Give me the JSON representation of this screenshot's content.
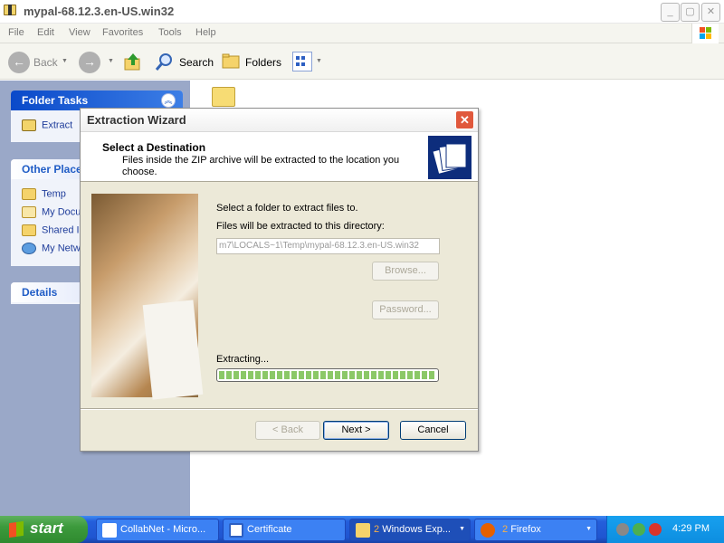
{
  "window": {
    "title": "mypal-68.12.3.en-US.win32"
  },
  "menu": [
    "File",
    "Edit",
    "View",
    "Favorites",
    "Tools",
    "Help"
  ],
  "toolbar": {
    "back_label": "Back",
    "search_label": "Search",
    "folders_label": "Folders"
  },
  "leftpane": {
    "folder_tasks": {
      "title": "Folder Tasks",
      "items": [
        "Extract"
      ]
    },
    "other_places": {
      "title": "Other Place",
      "items": [
        "Temp",
        "My Docu",
        "Shared I",
        "My Netw"
      ]
    },
    "details": {
      "title": "Details"
    }
  },
  "dialog": {
    "title": "Extraction Wizard",
    "header_title": "Select a Destination",
    "header_subtitle": "Files inside the ZIP archive will be extracted to the location you choose.",
    "select_folder_text": "Select a folder to extract files to.",
    "directory_label": "Files will be extracted to this directory:",
    "path_value": "m7\\LOCALS~1\\Temp\\mypal-68.12.3.en-US.win32",
    "browse_label": "Browse...",
    "password_label": "Password...",
    "status_text": "Extracting...",
    "progress": 1.0,
    "back_label": "< Back",
    "next_label": "Next >",
    "cancel_label": "Cancel"
  },
  "taskbar": {
    "start_label": "start",
    "buttons": [
      "CollabNet - Micro...",
      "Certificate",
      "Windows Exp...",
      "Firefox"
    ],
    "explorer_count": "2",
    "firefox_count": "2",
    "clock": "4:29 PM"
  },
  "colors": {
    "accent": "#215dc6",
    "progress": "#8bc867",
    "start": "#3c9a3c"
  }
}
